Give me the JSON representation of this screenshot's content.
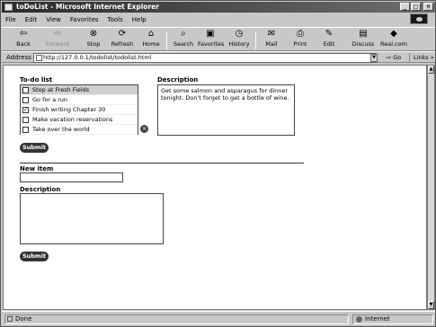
{
  "window": {
    "title": "toDoList - Microsoft Internet Explorer"
  },
  "menu": [
    "File",
    "Edit",
    "View",
    "Favorites",
    "Tools",
    "Help"
  ],
  "toolbar": {
    "back": "Back",
    "forward": "Forward",
    "stop": "Stop",
    "refresh": "Refresh",
    "home": "Home",
    "search": "Search",
    "favorites": "Favorites",
    "history": "History",
    "mail": "Mail",
    "print": "Print",
    "edit": "Edit",
    "discuss": "Discuss",
    "real": "Real.com"
  },
  "address": {
    "label": "Address",
    "url": "http://127.0.0.1/todolist/todolist.html",
    "go": "Go",
    "links": "Links"
  },
  "page": {
    "todo_label": "To-do list",
    "todo_items": [
      {
        "text": "Stop at Fresh Fields",
        "checked": false
      },
      {
        "text": "Go for a run",
        "checked": false
      },
      {
        "text": "Finish writing Chapter 30",
        "checked": true
      },
      {
        "text": "Make vacation reservations",
        "checked": false
      },
      {
        "text": "Take over the world",
        "checked": false
      }
    ],
    "description_label": "Description",
    "description_text": "Get some salmon and asparagus for dinner tonight.  Don't forget to get a bottle of wine.",
    "submit": "Submit",
    "new_item_label": "New item",
    "new_description_label": "Description",
    "submit2": "Submit"
  },
  "status": {
    "left": "Done",
    "zone": "Internet"
  }
}
